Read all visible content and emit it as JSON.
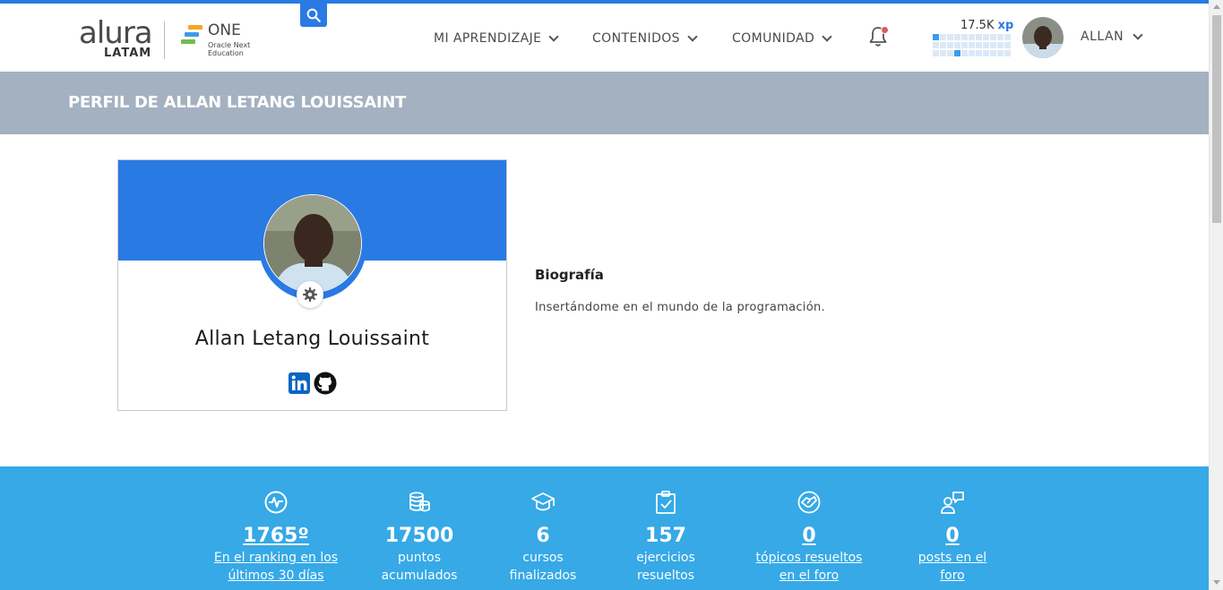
{
  "brand": {
    "alura_word": "alura",
    "alura_sub": "LATAM",
    "one_name": "ONE",
    "one_tagline": "Oracle Next Education"
  },
  "nav": [
    {
      "label": "MI APRENDIZAJE"
    },
    {
      "label": "CONTENIDOS"
    },
    {
      "label": "COMUNIDAD"
    }
  ],
  "user": {
    "xp_value": "17.5K",
    "xp_unit": "xp",
    "name": "ALLAN"
  },
  "page": {
    "title": "PERFIL DE ALLAN LETANG LOUISSAINT"
  },
  "profile": {
    "full_name": "Allan Letang Louissaint"
  },
  "bio": {
    "title": "Biografía",
    "text": "Insertándome en el mundo de la programación."
  },
  "stats": [
    {
      "value": "1765º",
      "label_line1": "En el ranking en los",
      "label_line2": "últimos 30 días",
      "icon": "pulse-icon"
    },
    {
      "value": "17500",
      "label_line1": "puntos",
      "label_line2": "acumulados",
      "icon": "coins-icon"
    },
    {
      "value": "6",
      "label_line1": "cursos",
      "label_line2": "finalizados",
      "icon": "graduation-cap-icon"
    },
    {
      "value": "157",
      "label_line1": "ejercicios",
      "label_line2": "resueltos",
      "icon": "clipboard-check-icon"
    },
    {
      "value": "0",
      "label_line1": "tópicos resueltos",
      "label_line2": "en el foro",
      "icon": "handshake-icon"
    },
    {
      "value": "0",
      "label_line1": "posts en el",
      "label_line2": "foro",
      "icon": "person-comment-icon"
    }
  ],
  "colors": {
    "accent": "#2a7ae4",
    "band": "#a4b1c1",
    "stats_bg": "#36a9e6",
    "notification_dot": "#e05b5b"
  }
}
